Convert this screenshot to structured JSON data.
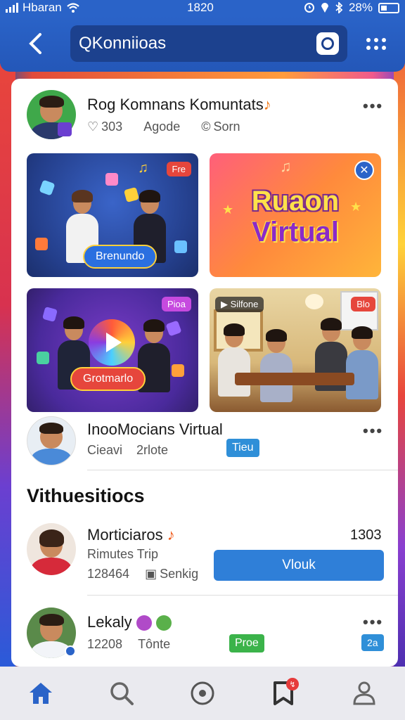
{
  "status_bar": {
    "carrier": "Hbaran",
    "time": "1820",
    "battery": "28%"
  },
  "header": {
    "search_text": "QKonniioas"
  },
  "post1": {
    "author": "Rog Komnans Komuntats",
    "stat1": "303",
    "stat2": "Agode",
    "stat3": "Sorn"
  },
  "tiles": [
    {
      "badge": "Fre",
      "button": "Brenundo"
    },
    {
      "line1": "Ruaon",
      "line2": "Virtual"
    },
    {
      "badge": "Pioa",
      "button": "Grotmarlo"
    },
    {
      "badge": "Silfone",
      "badge2": "Blo"
    }
  ],
  "post2": {
    "author": "InooMocians Virtual",
    "meta1": "Cieavi",
    "meta2": "2rlote",
    "tag": "Tieu"
  },
  "section": {
    "title": "Vithuesitiocs"
  },
  "item1": {
    "name": "Morticiaros",
    "subtitle": "Rimutes Trip",
    "meta1": "128464",
    "meta2": "Senkig",
    "count": "1303",
    "button": "Vlouk"
  },
  "item2": {
    "name": "Lekaly",
    "meta1": "12208",
    "meta2": "Tônte",
    "tag": "Proe",
    "tag2": "2a"
  },
  "colors": {
    "primary": "#2a63c8",
    "button": "#2f7fd8",
    "green": "#3bb34a",
    "badge_red": "#e63b3b"
  }
}
